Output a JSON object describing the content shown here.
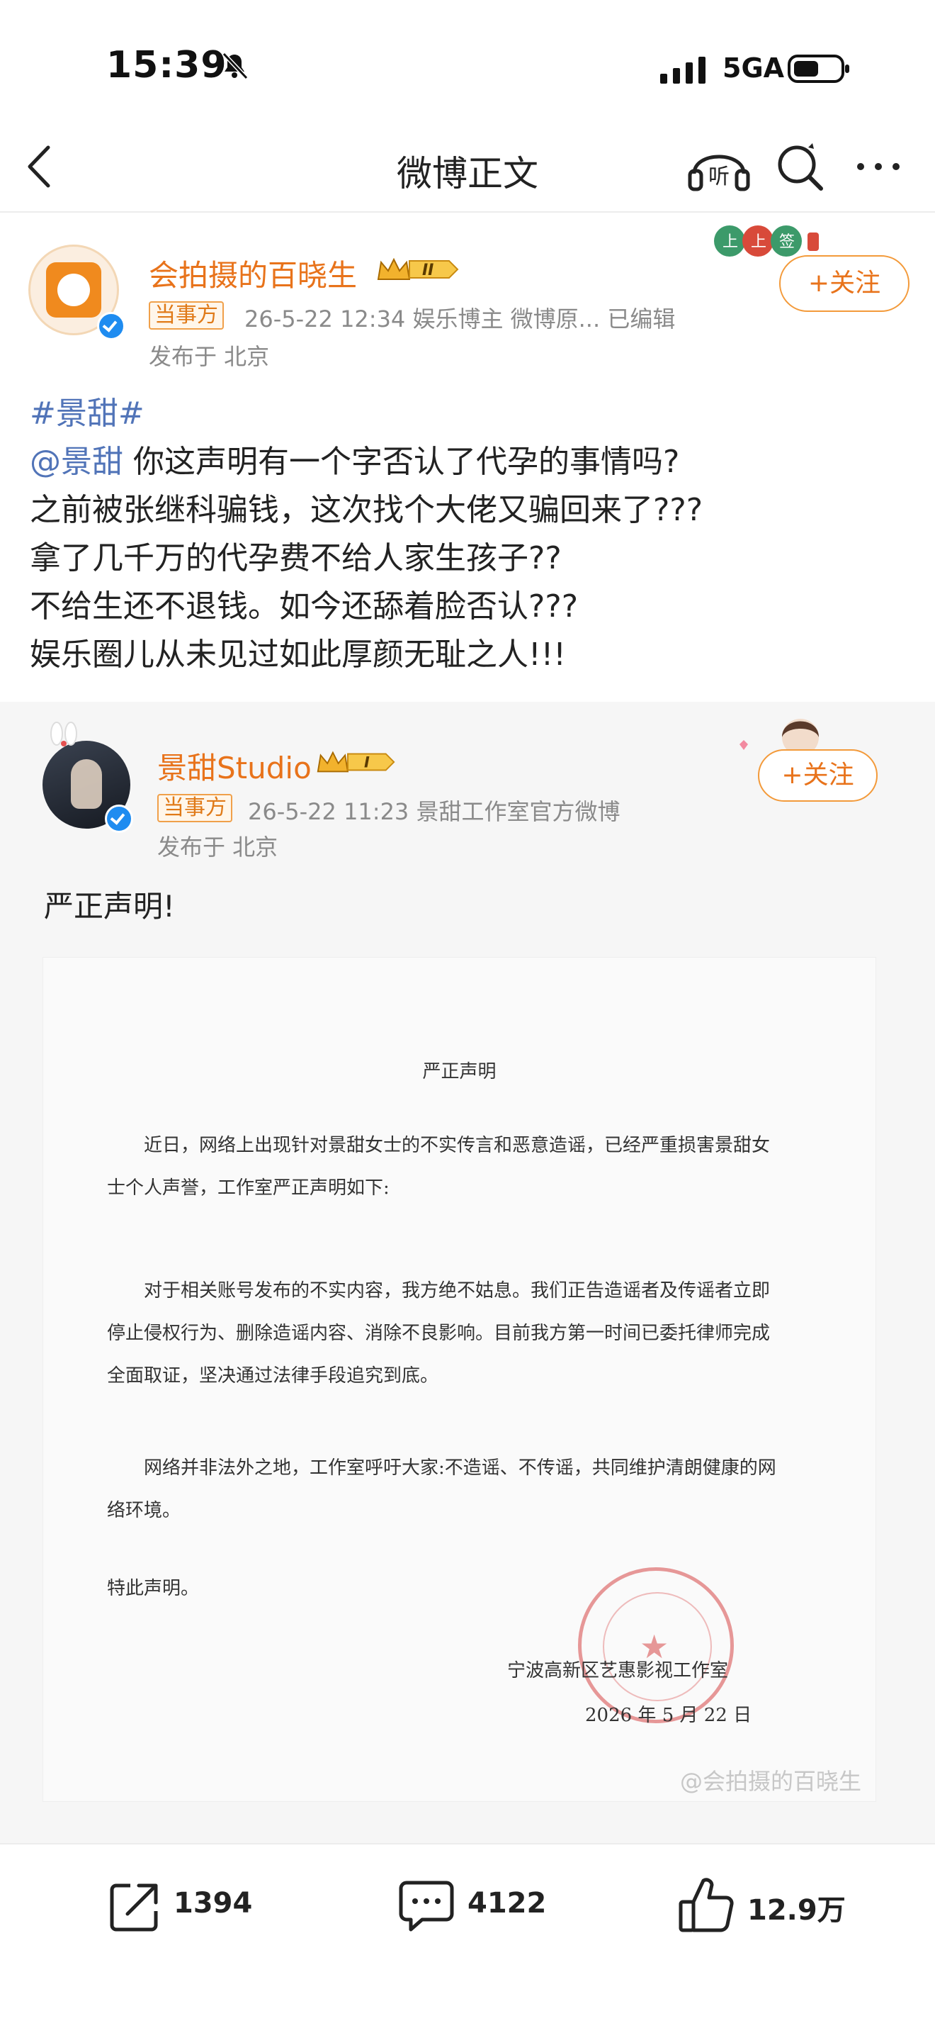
{
  "status_bar": {
    "time": "15:39",
    "network": "5GA"
  },
  "nav": {
    "title": "微博正文"
  },
  "author": {
    "name": "会拍摄的百晓生",
    "rank": "II",
    "tag": "当事方",
    "meta": "26-5-22 12:34  娱乐博主 微博原...  已编辑",
    "location": "发布于 北京",
    "follow_label": "+关注"
  },
  "post": {
    "hashtag": "#景甜#",
    "mention": "@景甜",
    "line1_rest": " 你这声明有一个字否认了代孕的事情吗?",
    "line2": "之前被张继科骗钱，这次找个大佬又骗回来了???",
    "line3": "拿了几千万的代孕费不给人家生孩子??",
    "line4": "不给生还不退钱。如今还舔着脸否认???",
    "line5": "娱乐圈儿从未见过如此厚颜无耻之人!!!"
  },
  "repost": {
    "author": {
      "name": "景甜Studio",
      "rank": "I",
      "tag": "当事方",
      "meta": "26-5-22 11:23  景甜工作室官方微博",
      "location": "发布于 北京",
      "follow_label": "+关注"
    },
    "text": "严正声明!"
  },
  "document": {
    "title": "严正声明",
    "p1": "近日，网络上出现针对景甜女士的不实传言和恶意造谣，已经严重损害景甜女士个人声誉，工作室严正声明如下:",
    "p2": "对于相关账号发布的不实内容，我方绝不姑息。我们正告造谣者及传谣者立即停止侵权行为、删除造谣内容、消除不良影响。目前我方第一时间已委托律师完成全面取证，坚决通过法律手段追究到底。",
    "p3": "网络并非法外之地，工作室呼吁大家:不造谣、不传谣，共同维护清朗健康的网络环境。",
    "closing": "特此声明。",
    "signatory": "宁波高新区艺惠影视工作室",
    "date": "2026 年 5 月 22 日",
    "seal_text": "宁波高新区艺惠影视工作室"
  },
  "watermark": "@会拍摄的百晓生",
  "actions": {
    "share_count": "1394",
    "comment_count": "4122",
    "like_count": "12.9万"
  },
  "colors": {
    "accent": "#e8731b",
    "link": "#5174b8",
    "verified": "#1f8cf0"
  }
}
